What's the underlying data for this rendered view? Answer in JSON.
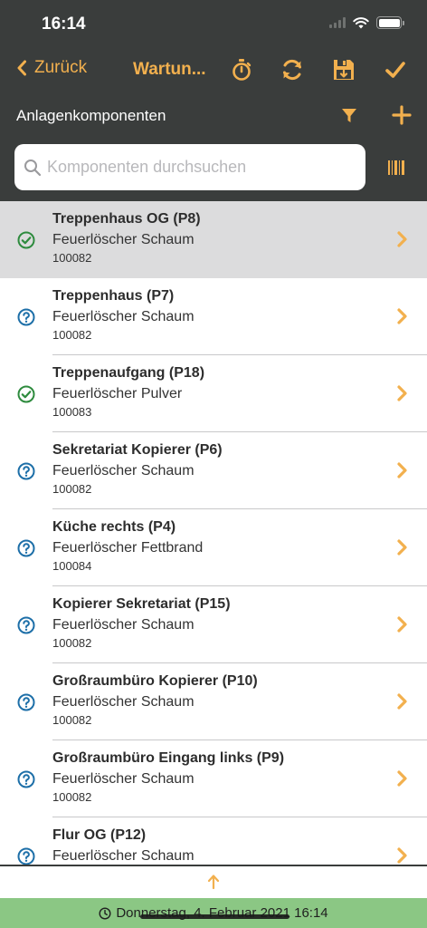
{
  "status_bar": {
    "time": "16:14"
  },
  "nav": {
    "back_label": "Zurück",
    "title": "Wartun...",
    "accent_color": "#f2b04e"
  },
  "toolbar": {
    "title": "Anlagenkomponenten"
  },
  "search": {
    "placeholder": "Komponenten durchsuchen",
    "value": ""
  },
  "colors": {
    "ok_status": "#2e8b3e",
    "unknown_status": "#1d6fa8",
    "header_bg": "#3a3d3c",
    "footer_bg": "#8bc784"
  },
  "items": [
    {
      "title": "Treppenhaus OG (P8)",
      "subtitle": "Feuerlöscher Schaum",
      "number": "100082",
      "status": "check-circle-icon",
      "selected": true
    },
    {
      "title": "Treppenhaus (P7)",
      "subtitle": "Feuerlöscher Schaum",
      "number": "100082",
      "status": "question-circle-icon",
      "selected": false
    },
    {
      "title": "Treppenaufgang  (P18)",
      "subtitle": "Feuerlöscher Pulver",
      "number": "100083",
      "status": "check-circle-icon",
      "selected": false
    },
    {
      "title": "Sekretariat Kopierer (P6)",
      "subtitle": "Feuerlöscher Schaum",
      "number": "100082",
      "status": "question-circle-icon",
      "selected": false
    },
    {
      "title": "Küche rechts (P4)",
      "subtitle": "Feuerlöscher Fettbrand",
      "number": "100084",
      "status": "question-circle-icon",
      "selected": false
    },
    {
      "title": "Kopierer Sekretariat  (P15)",
      "subtitle": "Feuerlöscher Schaum",
      "number": "100082",
      "status": "question-circle-icon",
      "selected": false
    },
    {
      "title": "Großraumbüro Kopierer (P10)",
      "subtitle": "Feuerlöscher Schaum",
      "number": "100082",
      "status": "question-circle-icon",
      "selected": false
    },
    {
      "title": "Großraumbüro Eingang links (P9)",
      "subtitle": "Feuerlöscher Schaum",
      "number": "100082",
      "status": "question-circle-icon",
      "selected": false
    },
    {
      "title": "Flur OG (P12)",
      "subtitle": "Feuerlöscher Schaum",
      "number": "",
      "status": "question-circle-icon",
      "selected": false
    }
  ],
  "footer": {
    "datetime": "Donnerstag, 4. Februar 2021 16:14"
  }
}
